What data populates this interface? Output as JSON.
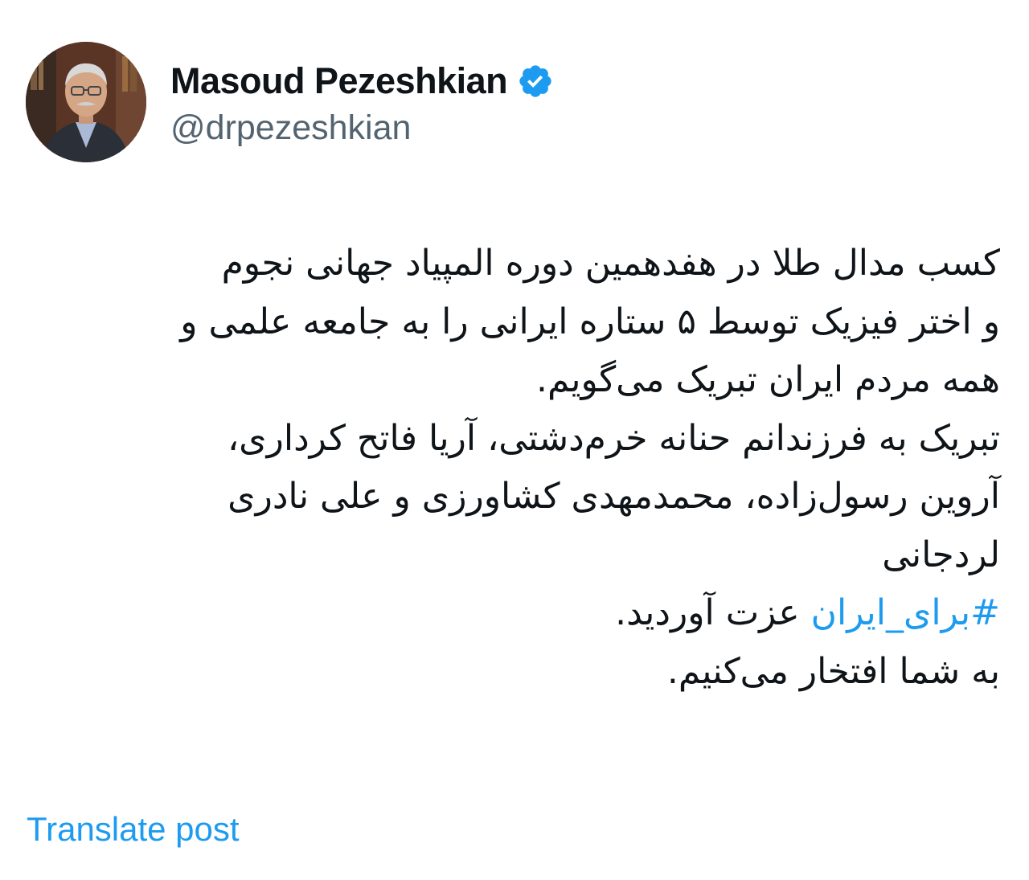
{
  "post": {
    "author": {
      "display_name": "Masoud Pezeshkian",
      "handle": "@drpezeshkian",
      "verified": true,
      "avatar_icon": "profile-photo"
    },
    "body_lines": [
      "کسب مدال طلا در هفدهمین دوره المپیاد جهانی نجوم",
      "و اختر فیزیک توسط ۵ ستاره ایرانی را به جامعه علمی و",
      "همه مردم ایران تبریک می‌گویم.",
      "تبریک به فرزندانم حنانه خرم‌دشتی، آریا فاتح کرداری،",
      "آروین رسول‌زاده، محمدمهدی کشاورزی و علی نادری",
      "لردجانی"
    ],
    "hashtag_line": {
      "hashtag": "#برای_ایران",
      "rest": " عزت آوردید."
    },
    "closing_line": "به شما افتخار می‌کنیم.",
    "translate_label": "Translate post"
  },
  "colors": {
    "text": "#0f1419",
    "secondary": "#536471",
    "accent": "#1d9bf0",
    "background": "#ffffff"
  }
}
